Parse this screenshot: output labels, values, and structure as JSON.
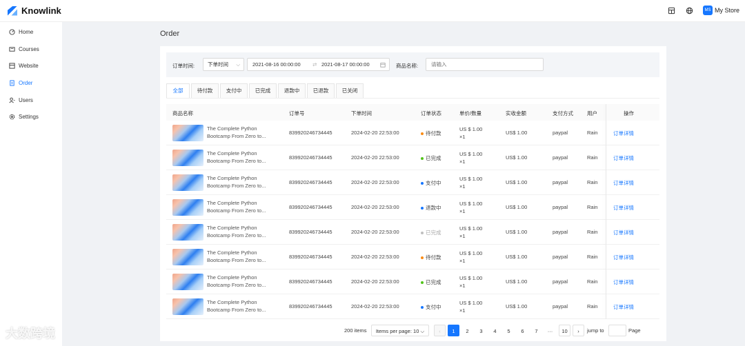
{
  "app": {
    "name": "Knowlink"
  },
  "header": {
    "store_name": "My Store",
    "avatar_initials": "MS"
  },
  "sidebar": {
    "items": [
      {
        "label": "Home",
        "icon": "dashboard-icon"
      },
      {
        "label": "Courses",
        "icon": "courses-icon"
      },
      {
        "label": "Website",
        "icon": "website-icon"
      },
      {
        "label": "Order",
        "icon": "order-icon",
        "active": true
      },
      {
        "label": "Users",
        "icon": "users-icon"
      },
      {
        "label": "Settings",
        "icon": "gear-icon"
      }
    ]
  },
  "page": {
    "title": "Order"
  },
  "filters": {
    "order_time_label": "订单时间:",
    "order_time_select": "下单时间",
    "date_start": "2021-08-16 00:00:00",
    "date_end": "2021-08-17 00:00:00",
    "product_name_label": "商品名称:",
    "product_name_placeholder": "请输入"
  },
  "tabs": [
    "全部",
    "待付款",
    "支付中",
    "已完成",
    "退款中",
    "已退款",
    "已关闭"
  ],
  "table": {
    "columns": [
      "商品名称",
      "订单号",
      "下单时间",
      "订单状态",
      "单价/数量",
      "实收金额",
      "支付方式",
      "用户",
      "操作"
    ],
    "rows": [
      {
        "product_line1": "The Complete Python",
        "product_line2": "Bootcamp From Zero to...",
        "order_no": "839920246734445",
        "time": "2024-02-20 22:53:00",
        "status": "待付款",
        "status_color": "#fa8c16",
        "price": "US $ 1.00",
        "qty": "×1",
        "amount": "US$ 1.00",
        "pay": "paypal",
        "user": "Rain",
        "action": "订单详情"
      },
      {
        "product_line1": "The Complete Python",
        "product_line2": "Bootcamp From Zero to...",
        "order_no": "839920246734445",
        "time": "2024-02-20 22:53:00",
        "status": "已完成",
        "status_color": "#52c41a",
        "price": "US $ 1.00",
        "qty": "×1",
        "amount": "US$ 1.00",
        "pay": "paypal",
        "user": "Rain",
        "action": "订单详情"
      },
      {
        "product_line1": "The Complete Python",
        "product_line2": "Bootcamp From Zero to...",
        "order_no": "839920246734445",
        "time": "2024-02-20 22:53:00",
        "status": "支付中",
        "status_color": "#1677ff",
        "price": "US $ 1.00",
        "qty": "×1",
        "amount": "US$ 1.00",
        "pay": "paypal",
        "user": "Rain",
        "action": "订单详情"
      },
      {
        "product_line1": "The Complete Python",
        "product_line2": "Bootcamp From Zero to...",
        "order_no": "839920246734445",
        "time": "2024-02-20 22:53:00",
        "status": "退款中",
        "status_color": "#1677ff",
        "price": "US $ 1.00",
        "qty": "×1",
        "amount": "US$ 1.00",
        "pay": "paypal",
        "user": "Rain",
        "action": "订单详情"
      },
      {
        "product_line1": "The Complete Python",
        "product_line2": "Bootcamp From Zero to...",
        "order_no": "839920246734445",
        "time": "2024-02-20 22:53:00",
        "status": "已完成",
        "status_color": "#bfbfbf",
        "price": "US $ 1.00",
        "qty": "×1",
        "amount": "US$ 1.00",
        "pay": "paypal",
        "user": "Rain",
        "action": "订单详情"
      },
      {
        "product_line1": "The Complete Python",
        "product_line2": "Bootcamp From Zero to...",
        "order_no": "839920246734445",
        "time": "2024-02-20 22:53:00",
        "status": "待付款",
        "status_color": "#fa8c16",
        "price": "US $ 1.00",
        "qty": "×1",
        "amount": "US$ 1.00",
        "pay": "paypal",
        "user": "Rain",
        "action": "订单详情"
      },
      {
        "product_line1": "The Complete Python",
        "product_line2": "Bootcamp From Zero to...",
        "order_no": "839920246734445",
        "time": "2024-02-20 22:53:00",
        "status": "已完成",
        "status_color": "#52c41a",
        "price": "US $ 1.00",
        "qty": "×1",
        "amount": "US$ 1.00",
        "pay": "paypal",
        "user": "Rain",
        "action": "订单详情"
      },
      {
        "product_line1": "The Complete Python",
        "product_line2": "Bootcamp From Zero to...",
        "order_no": "839920246734445",
        "time": "2024-02-20 22:53:00",
        "status": "支付中",
        "status_color": "#1677ff",
        "price": "US $ 1.00",
        "qty": "×1",
        "amount": "US$ 1.00",
        "pay": "paypal",
        "user": "Rain",
        "action": "订单详情"
      }
    ]
  },
  "pagination": {
    "total": "200 items",
    "items_per_page": "Items per page: 10",
    "pages": [
      "1",
      "2",
      "3",
      "4",
      "5",
      "6",
      "7",
      "···",
      "10"
    ],
    "current": "1",
    "jump_to": "jump to",
    "page_suffix": "Page"
  },
  "watermark": "大数跨境",
  "colors": {
    "accent": "#1677ff",
    "background": "#f0f2f5"
  }
}
